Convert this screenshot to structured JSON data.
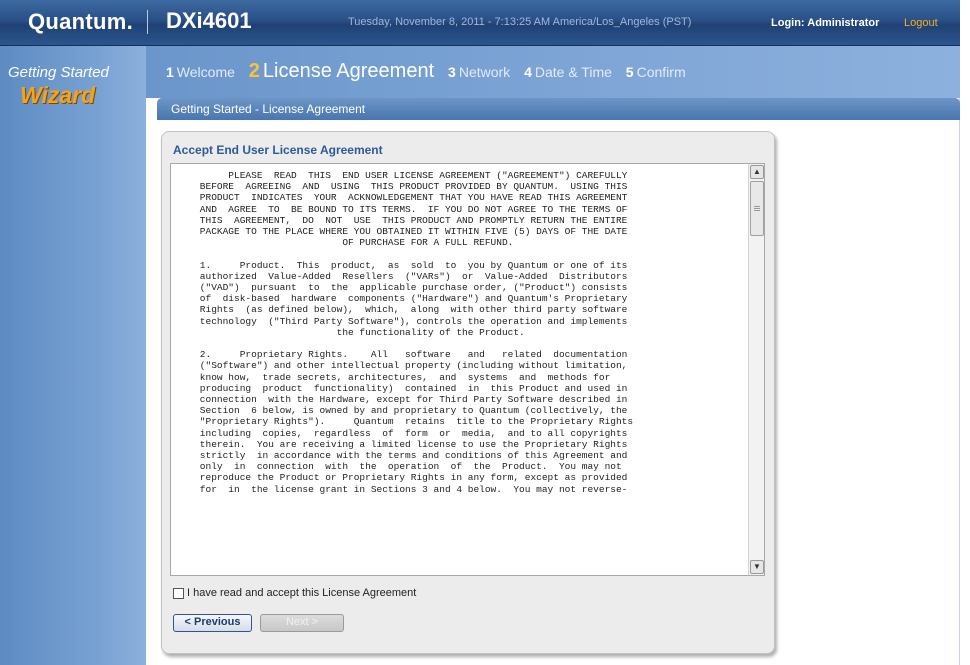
{
  "header": {
    "logo": "Quantum.",
    "product": "DXi4601",
    "datetime": "Tuesday, November 8, 2011 - 7:13:25 AM America/Los_Angeles (PST)",
    "login": "Login: Administrator",
    "logout": "Logout"
  },
  "sidebar": {
    "title": "Getting Started",
    "wizard": "Wizard"
  },
  "steps": [
    {
      "num": "1",
      "label": "Welcome"
    },
    {
      "num": "2",
      "label": "License Agreement"
    },
    {
      "num": "3",
      "label": "Network"
    },
    {
      "num": "4",
      "label": "Date & Time"
    },
    {
      "num": "5",
      "label": "Confirm"
    }
  ],
  "section": {
    "title": "Getting Started - License Agreement"
  },
  "eula": {
    "title": "Accept End User License Agreement",
    "text": "         PLEASE  READ  THIS  END USER LICENSE AGREEMENT (\"AGREEMENT\") CAREFULLY\n    BEFORE  AGREEING  AND  USING  THIS PRODUCT PROVIDED BY QUANTUM.  USING THIS\n    PRODUCT  INDICATES  YOUR  ACKNOWLEDGEMENT THAT YOU HAVE READ THIS AGREEMENT\n    AND  AGREE  TO  BE BOUND TO ITS TERMS.  IF YOU DO NOT AGREE TO THE TERMS OF\n    THIS  AGREEMENT,  DO  NOT  USE  THIS PRODUCT AND PROMPTLY RETURN THE ENTIRE\n    PACKAGE TO THE PLACE WHERE YOU OBTAINED IT WITHIN FIVE (5) DAYS OF THE DATE\n                             OF PURCHASE FOR A FULL REFUND.\n\n    1.     Product.  This  product,  as  sold  to  you by Quantum or one of its\n    authorized  Value-Added  Resellers  (\"VARs\")  or  Value-Added  Distributors\n    (\"VAD\")  pursuant  to  the  applicable purchase order, (\"Product\") consists\n    of  disk-based  hardware  components (\"Hardware\") and Quantum's Proprietary\n    Rights  (as defined below),  which,  along  with other third party software\n    technology  (\"Third Party Software\"), controls the operation and implements\n                            the functionality of the Product.\n\n    2.     Proprietary Rights.    All   software   and   related  documentation\n    (\"Software\") and other intellectual property (including without limitation,\n    know how,  trade secrets, architectures,  and  systems  and  methods for\n    producing  product  functionality)  contained  in  this Product and used in\n    connection  with the Hardware, except for Third Party Software described in\n    Section  6 below, is owned by and proprietary to Quantum (collectively, the\n    \"Proprietary Rights\").     Quantum  retains  title to the Proprietary Rights\n    including  copies,  regardless  of  form  or  media,  and to all copyrights\n    therein.  You are receiving a limited license to use the Proprietary Rights\n    strictly  in accordance with the terms and conditions of this Agreement and\n    only  in  connection  with  the  operation  of  the  Product.  You may not\n    reproduce the Product or Proprietary Rights in any form, except as provided\n    for  in  the license grant in Sections 3 and 4 below.  You may not reverse-",
    "accept_label": "I have read and accept this License Agreement"
  },
  "buttons": {
    "previous": "< Previous",
    "next": "Next >"
  }
}
